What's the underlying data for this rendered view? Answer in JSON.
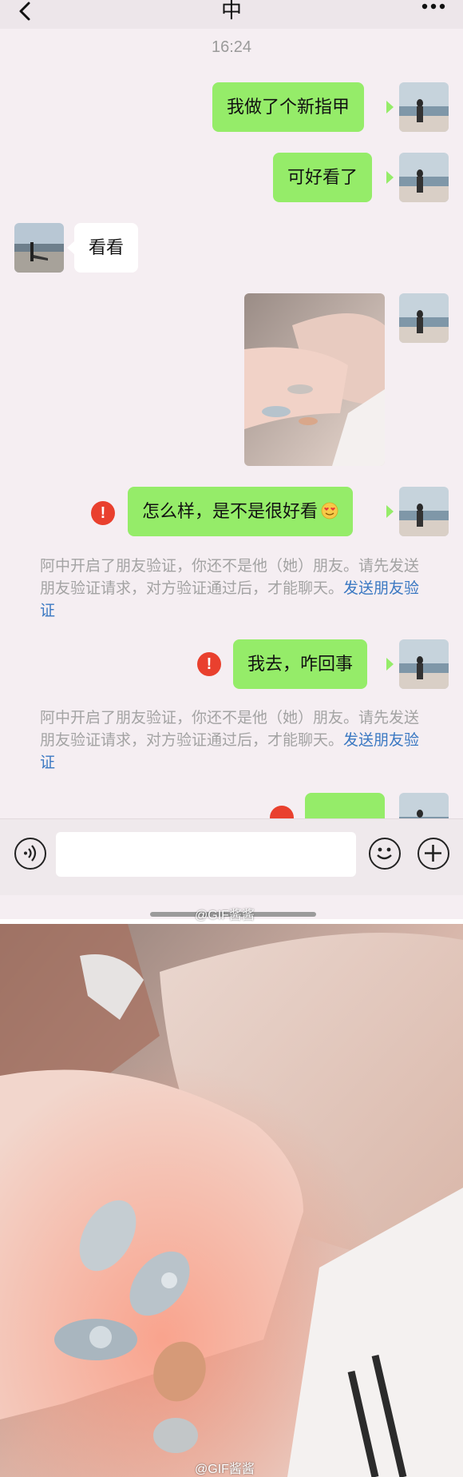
{
  "header": {
    "title": "中"
  },
  "timestamp": "16:24",
  "messages": [
    {
      "side": "right",
      "text": "我做了个新指甲"
    },
    {
      "side": "right",
      "text": "可好看了"
    },
    {
      "side": "left",
      "text": "看看"
    },
    {
      "side": "right",
      "type": "image"
    },
    {
      "side": "right",
      "text": "怎么样，是不是很好看",
      "failed": true,
      "emoji": "heart-eyes"
    },
    {
      "side": "right",
      "text": "我去，咋回事",
      "failed": true
    }
  ],
  "system_notices": [
    {
      "text": "阿中开启了朋友验证，你还不是他（她）朋友。请先发送朋友验证请求，对方验证通过后，才能聊天。",
      "link": "发送朋友验证"
    },
    {
      "text": "阿中开启了朋友验证，你还不是他（她）朋友。请先发送朋友验证请求，对方验证通过后，才能聊天。",
      "link": "发送朋友验证"
    }
  ],
  "error_symbol": "!",
  "watermark": "@GIF酱酱",
  "colors": {
    "bubble_green": "#95ec69",
    "error_red": "#e9402e",
    "link_blue": "#3a78c2"
  },
  "icons": [
    "back-icon",
    "more-icon",
    "voice-icon",
    "emoji-icon",
    "plus-icon"
  ]
}
